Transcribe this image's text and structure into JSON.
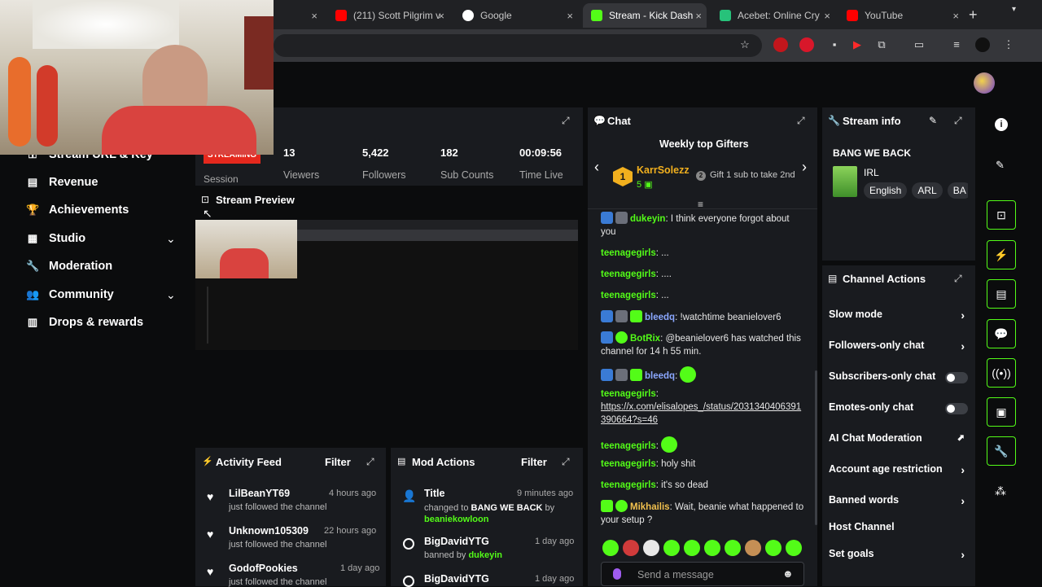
{
  "browser": {
    "tabs": [
      {
        "title": "(211) Scott Pilgrim v",
        "color": "#ff0000"
      },
      {
        "title": "Google",
        "color": "#4285f4"
      },
      {
        "title": "Stream - Kick Dash",
        "color": "#53fc18"
      },
      {
        "title": "Acebet: Online Cry",
        "color": "#27c27a"
      },
      {
        "title": "YouTube",
        "color": "#ff0000"
      }
    ],
    "close_glyph": "×",
    "new_tab": "+"
  },
  "sidebar": {
    "items": [
      {
        "label": "Stream URL & Key",
        "icon": "key-icon"
      },
      {
        "label": "Revenue",
        "icon": "revenue-icon"
      },
      {
        "label": "Achievements",
        "icon": "trophy-icon"
      },
      {
        "label": "Studio",
        "icon": "studio-icon",
        "expandable": true
      },
      {
        "label": "Moderation",
        "icon": "wrench-icon"
      },
      {
        "label": "Community",
        "icon": "community-icon",
        "expandable": true
      },
      {
        "label": "Drops & rewards",
        "icon": "drops-icon"
      }
    ]
  },
  "session": {
    "badge": "STREAMING",
    "label": "Session",
    "stats": [
      {
        "value": "13",
        "label": "Viewers"
      },
      {
        "value": "5,422",
        "label": "Followers"
      },
      {
        "value": "182",
        "label": "Sub Counts"
      },
      {
        "value": "00:09:56",
        "label": "Time Live"
      }
    ]
  },
  "preview": {
    "title": "Stream Preview"
  },
  "activity": {
    "title": "Activity Feed",
    "filter": "Filter",
    "items": [
      {
        "name": "LilBeanYT69",
        "time": "4 hours ago",
        "text": "just followed the channel"
      },
      {
        "name": "Unknown105309",
        "time": "22 hours ago",
        "text": "just followed the channel"
      },
      {
        "name": "GodofPookies",
        "time": "1 day ago",
        "text": "just followed the channel"
      }
    ]
  },
  "mod": {
    "title": "Mod Actions",
    "filter": "Filter",
    "items": [
      {
        "name": "Title",
        "time": "9 minutes ago",
        "line1": "changed to ",
        "bold": "BANG WE BACK",
        "line2": " by ",
        "actor": "beaniekowloon"
      },
      {
        "name": "BigDavidYTG",
        "time": "1 day ago",
        "line1": "banned by ",
        "bold": "",
        "line2": "",
        "actor": "dukeyin"
      },
      {
        "name": "BigDavidYTG",
        "time": "1 day ago",
        "line1": "",
        "bold": "",
        "line2": "",
        "actor": ""
      }
    ]
  },
  "chat": {
    "title": "Chat",
    "gifters_title": "Weekly top Gifters",
    "top_gifter": {
      "rank": "1",
      "name": "KarrSolezz",
      "count": "5"
    },
    "second": {
      "rank": "2",
      "text": "Gift 1 sub to take 2nd"
    },
    "messages": [
      {
        "user": "dukeyin",
        "text": "I think everyone forgot about you"
      },
      {
        "user": "teenagegirls",
        "text": "..."
      },
      {
        "user": "teenagegirls",
        "text": "...."
      },
      {
        "user": "teenagegirls",
        "text": "..."
      },
      {
        "user": "bleedq",
        "text": "!watchtime beanielover6"
      },
      {
        "user": "BotRix",
        "text": "@beanielover6 has watched this channel for 14 h 55 min."
      },
      {
        "user": "bleedq",
        "text": ""
      },
      {
        "user": "teenagegirls",
        "text": "https://x.com/elisalopes_/status/2031340406391390664?s=46"
      },
      {
        "user": "teenagegirls",
        "text": ""
      },
      {
        "user": "teenagegirls",
        "text": "holy shit"
      },
      {
        "user": "teenagegirls",
        "text": "it's so dead"
      },
      {
        "user": "Mikhailis",
        "text": "Wait, beanie what happened to your setup ?"
      }
    ],
    "placeholder": "Send a message"
  },
  "stream_info": {
    "title": "Stream info",
    "stream_title": "BANG WE BACK",
    "category": "IRL",
    "tags": [
      "English",
      "ARL",
      "BA"
    ]
  },
  "channel_actions": {
    "title": "Channel Actions",
    "rows": [
      {
        "label": "Slow mode",
        "kind": "chevron"
      },
      {
        "label": "Followers-only chat",
        "kind": "chevron"
      },
      {
        "label": "Subscribers-only chat",
        "kind": "toggle"
      },
      {
        "label": "Emotes-only chat",
        "kind": "toggle"
      },
      {
        "label": "AI Chat Moderation",
        "kind": "external"
      },
      {
        "label": "Account age restriction",
        "kind": "chevron"
      },
      {
        "label": "Banned words",
        "kind": "chevron"
      },
      {
        "label": "Host Channel",
        "kind": "none"
      },
      {
        "label": "Set goals",
        "kind": "chevron"
      }
    ]
  },
  "colors": {
    "accent": "#53fc18",
    "streaming": "#e5281d",
    "panel": "#191b1f"
  }
}
